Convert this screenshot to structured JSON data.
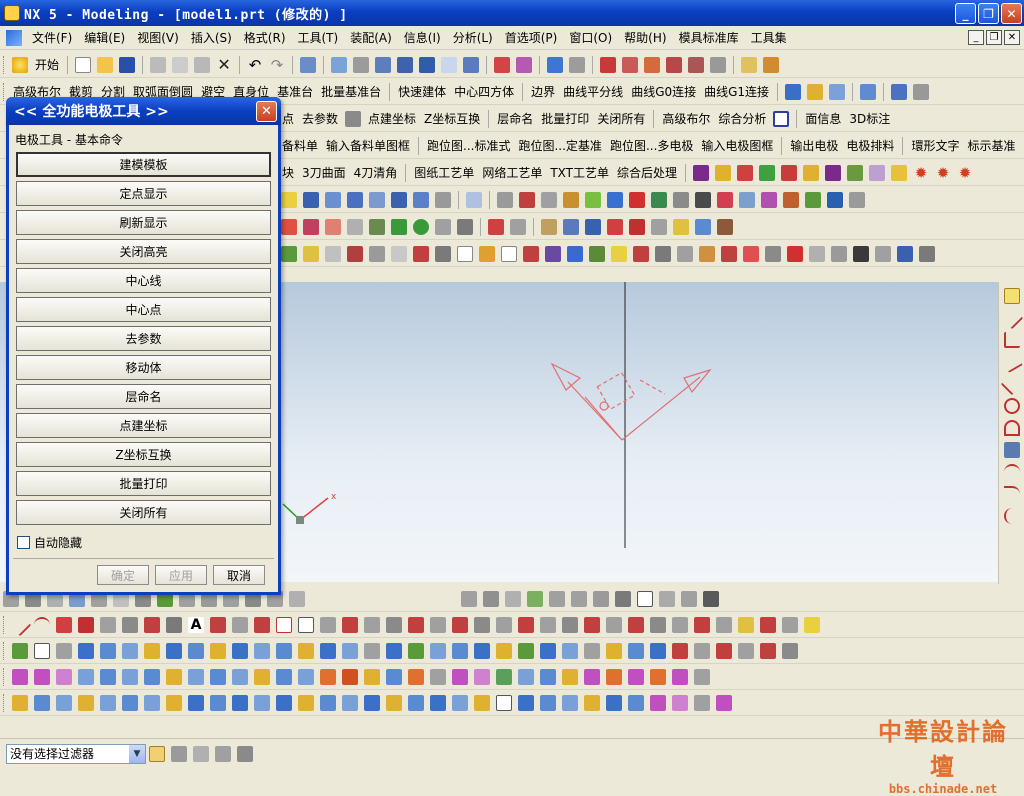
{
  "window": {
    "title": "NX 5 - Modeling - [model1.prt  (修改的)  ]"
  },
  "menu": [
    "文件(F)",
    "编辑(E)",
    "视图(V)",
    "插入(S)",
    "格式(R)",
    "工具(T)",
    "装配(A)",
    "信息(I)",
    "分析(L)",
    "首选项(P)",
    "窗口(O)",
    "帮助(H)",
    "模具标准库",
    "工具集"
  ],
  "toolbar1": {
    "start_label": "开始"
  },
  "toolbar2": {
    "items": [
      "高级布尔",
      "截剪",
      "分割",
      "取弧面倒圆",
      "避空",
      "直身位",
      "基准台",
      "批量基准台",
      "快速建体",
      "中心四方体",
      "边界",
      "曲线平分线",
      "曲线G0连接",
      "曲线G1连接"
    ]
  },
  "toolbar3": {
    "items": [
      "点",
      "去参数",
      "点建坐标",
      "Z坐标互换",
      "层命名",
      "批量打印",
      "关闭所有",
      "高级布尔",
      "综合分析",
      "面信息",
      "3D标注"
    ]
  },
  "toolbar4": {
    "items": [
      "备料单",
      "输入备料单图框",
      "跑位图...标准式",
      "跑位图...定基准",
      "跑位图...多电极",
      "输入电极图框",
      "输出电极",
      "电极排料",
      "環形文字",
      "标示基准"
    ]
  },
  "toolbar5": {
    "items": [
      "块",
      "3刀曲面",
      "4刀清角",
      "图纸工艺单",
      "网络工艺单",
      "TXT工艺单",
      "综合后处理"
    ]
  },
  "dialog": {
    "title": "<<  全功能电极工具  >>",
    "section": "电极工具 - 基本命令",
    "buttons": [
      "建模模板",
      "定点显示",
      "刷新显示",
      "关闭高亮",
      "中心线",
      "中心点",
      "去参数",
      "移动体",
      "层命名",
      "点建坐标",
      "Z坐标互换",
      "批量打印",
      "关闭所有"
    ],
    "autohide_label": "自动隐藏",
    "ok": "确定",
    "apply": "应用",
    "cancel": "取消"
  },
  "viewport": {
    "wcs_x_label": "x"
  },
  "status": {
    "filter_value": "没有选择过滤器"
  },
  "watermark": {
    "line1": "中華設計論壇",
    "line2": "bbs.chinade.net"
  },
  "colors": {
    "titlebar": "#0a3fc0",
    "viewport_top": "#b6c9dc",
    "wcs": "#e06060"
  }
}
